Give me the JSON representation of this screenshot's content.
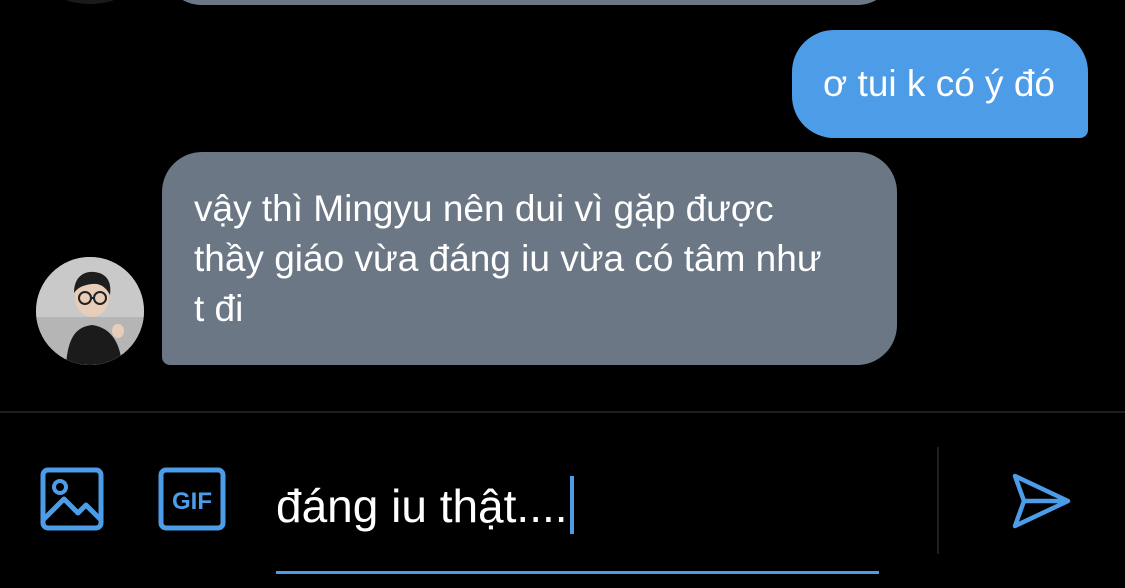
{
  "thread": {
    "messages": [
      {
        "direction": "outgoing",
        "text": "ơ tui k có ý đó"
      },
      {
        "direction": "incoming",
        "text": "vậy thì Mingyu nên dui vì gặp được thầy giáo vừa đáng iu vừa có tâm như t đi"
      }
    ]
  },
  "composer": {
    "input_value": "đáng iu thật....",
    "icons": {
      "media": "image-icon",
      "gif": "gif-icon",
      "send": "send-icon"
    },
    "gif_label": "GIF"
  },
  "colors": {
    "background": "#000000",
    "accent": "#4d9ce8",
    "incoming_bubble": "#6b7785",
    "outgoing_bubble": "#4d9ce8",
    "divider": "#1c1f23"
  }
}
